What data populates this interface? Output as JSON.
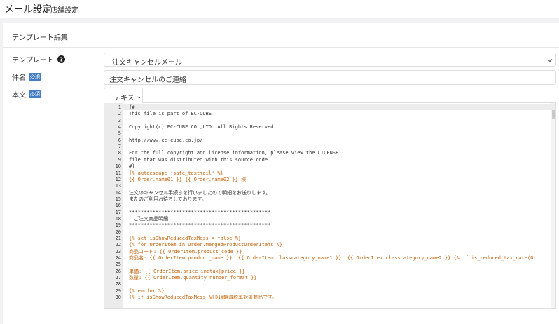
{
  "header": {
    "title": "メール設定",
    "subtitle": "店舗設定"
  },
  "card": {
    "title": "テンプレート編集"
  },
  "form": {
    "template_label": "テンプレート",
    "template_value": "注文キャンセルメール",
    "subject_label": "件名",
    "subject_value": "注文キャンセルのご連絡",
    "body_label": "本文",
    "required_badge": "必須",
    "tab_label": "テキスト"
  },
  "editor": {
    "lines": [
      {
        "n": "1",
        "t": "{#",
        "c": "code"
      },
      {
        "n": "2",
        "t": "This file is part of EC-CUBE",
        "c": "code"
      },
      {
        "n": "3",
        "t": "",
        "c": "code"
      },
      {
        "n": "4",
        "t": "Copyright(c) EC-CUBE CO.,LTD. All Rights Reserved.",
        "c": "code"
      },
      {
        "n": "5",
        "t": "",
        "c": "code"
      },
      {
        "n": "6",
        "t": "http://www.ec-cube.co.jp/",
        "c": "code"
      },
      {
        "n": "7",
        "t": "",
        "c": "code"
      },
      {
        "n": "8",
        "t": "For the full copyright and license information, please view the LICENSE",
        "c": "code"
      },
      {
        "n": "9",
        "t": "file that was distributed with this source code.",
        "c": "code"
      },
      {
        "n": "10",
        "t": "#}",
        "c": "code"
      },
      {
        "n": "11",
        "t": "{% autoescape 'safe_textmail' %}",
        "c": "tw"
      },
      {
        "n": "12",
        "t": "{{ Order.name01 }} {{ Order.name02 }} 様",
        "c": "tw"
      },
      {
        "n": "13",
        "t": "",
        "c": "code"
      },
      {
        "n": "14",
        "t": "注文のキャンセル手続きを行いましたので明細をお送りします。",
        "c": "code"
      },
      {
        "n": "15",
        "t": "またのご利用お待ちしております。",
        "c": "code"
      },
      {
        "n": "16",
        "t": "",
        "c": "code"
      },
      {
        "n": "17",
        "t": "************************************************",
        "c": "code"
      },
      {
        "n": "18",
        "t": "　ご注文商品明細",
        "c": "code"
      },
      {
        "n": "19",
        "t": "************************************************",
        "c": "code"
      },
      {
        "n": "20",
        "t": "",
        "c": "code"
      },
      {
        "n": "21",
        "t": "{% set isShowReducedTaxMess = false %}",
        "c": "tw"
      },
      {
        "n": "22",
        "t": "{% for OrderItem in Order.MergedProductOrderItems %}",
        "c": "tw"
      },
      {
        "n": "23",
        "t": "商品コード: {{ OrderItem.product_code }}",
        "c": "tw"
      },
      {
        "n": "24",
        "t": "商品名: {{ OrderItem.product_name }}  {{ OrderItem.classcategory_name1 }}  {{ OrderItem.classcategory_name2 }} {% if is_reduced_tax_rate(Or",
        "c": "tw"
      },
      {
        "n": "25",
        "t": "",
        "c": "code"
      },
      {
        "n": "26",
        "t": "単価: {{ OrderItem.price_inctax|price }}",
        "c": "tw"
      },
      {
        "n": "27",
        "t": "数量: {{ OrderItem.quantity number_format }}",
        "c": "tw"
      },
      {
        "n": "28",
        "t": "",
        "c": "code"
      },
      {
        "n": "29",
        "t": "{% endfor %}",
        "c": "tw"
      },
      {
        "n": "30",
        "t": "{% if isShowReducedTaxMess %}※は軽減税率対象商品です。",
        "c": "tw"
      }
    ]
  },
  "colors": {
    "badge": "#437ec4",
    "twig": "#c1620b",
    "gutter": "#ebebeb"
  }
}
